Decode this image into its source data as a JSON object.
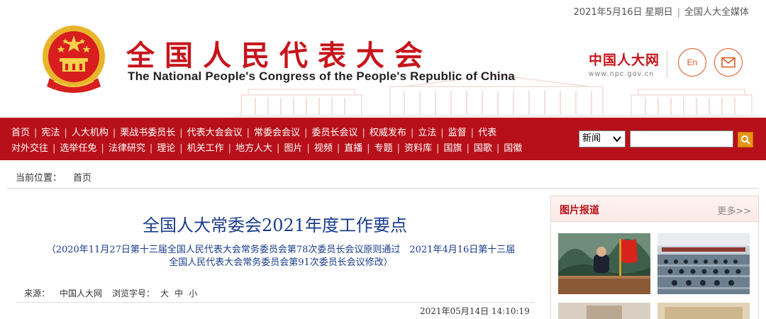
{
  "topbar": {
    "date": "2021年5月16日 星期日",
    "separator": "|",
    "media_link": "全国人大全媒体"
  },
  "header": {
    "title_cn": "全国人民代表大会",
    "title_en": "The National People's Congress of the People's Republic of China",
    "npc_logo_cn": "中国人大网",
    "npc_logo_url": "www.npc.gov.cn",
    "en_button": "En",
    "mail_icon": "mail-icon",
    "emblem_icon": "national-emblem-icon"
  },
  "nav": {
    "row1": [
      "首页",
      "宪法",
      "人大机构",
      "栗战书委员长",
      "代表大会会议",
      "常委会会议",
      "委员长会议",
      "权威发布",
      "立法",
      "监督",
      "代表"
    ],
    "row2": [
      "对外交往",
      "选举任免",
      "法律研究",
      "理论",
      "机关工作",
      "地方人大",
      "图片",
      "视频",
      "直播",
      "专题",
      "资料库",
      "国旗",
      "国歌",
      "国徽"
    ],
    "separator": "|",
    "search": {
      "category": "新闻",
      "button_icon": "search-icon"
    }
  },
  "breadcrumb": {
    "label": "当前位置：",
    "home": "首页"
  },
  "article": {
    "title": "全国人大常委会2021年度工作要点",
    "subtitle_line1": "（2020年11月27日第十三届全国人民代表大会常务委员会第78次委员长会议原则通过　2021年4月16日第十三届",
    "subtitle_line2": "全国人民代表大会常务委员会第91次委员长会议修改）",
    "source_label": "来源：",
    "source": "中国人大网",
    "fontsize_label": "浏览字号：",
    "font_large": "大",
    "font_medium": "中",
    "font_small": "小",
    "published": "2021年05月14日  14:10:19"
  },
  "sidebar": {
    "photo_title": "图片报道",
    "more": "更多>>"
  },
  "colors": {
    "brand_red": "#b8101a",
    "title_red": "#c8141b",
    "title_blue": "#1a3c8c",
    "search_orange": "#e89414"
  }
}
